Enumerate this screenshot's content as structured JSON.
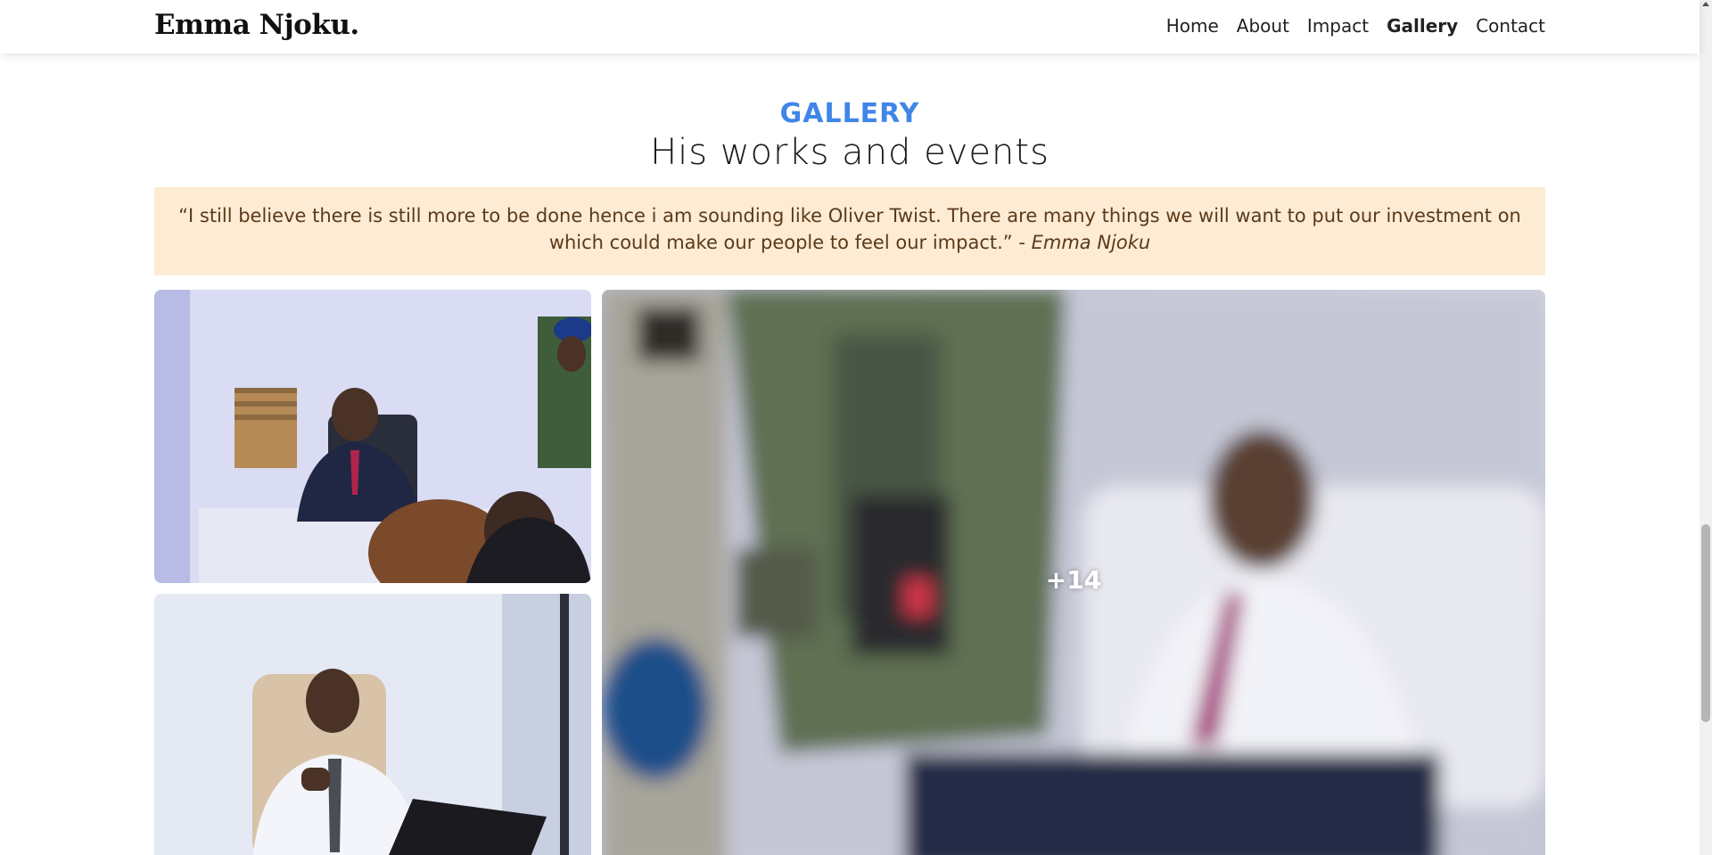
{
  "header": {
    "brand": "Emma Njoku.",
    "nav": [
      {
        "label": "Home",
        "active": false
      },
      {
        "label": "About",
        "active": false
      },
      {
        "label": "Impact",
        "active": false
      },
      {
        "label": "Gallery",
        "active": true
      },
      {
        "label": "Contact",
        "active": false
      }
    ]
  },
  "gallery": {
    "eyebrow": "GALLERY",
    "title": "His works and events",
    "quote": "“I still believe there is still more to be done hence i am sounding like Oliver Twist. There are many things we will want to put our investment on which could make our people to feel our impact.” - ",
    "quote_author": "Emma Njoku",
    "more_count": "+14"
  },
  "colors": {
    "accent": "#3f86e8",
    "quote_bg": "#fdebd3",
    "quote_text": "#5a3a1a"
  }
}
